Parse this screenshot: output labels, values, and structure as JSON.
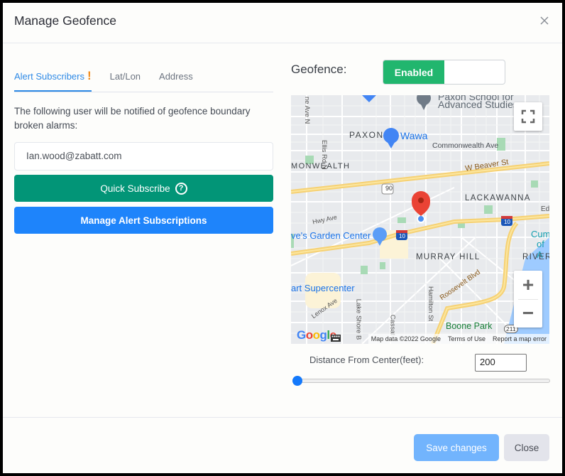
{
  "dialog": {
    "title": "Manage Geofence",
    "close_icon": "close-x-icon"
  },
  "tabs": [
    {
      "label": "Alert Subscribers",
      "active": true,
      "badge": "!"
    },
    {
      "label": "Lat/Lon",
      "active": false
    },
    {
      "label": "Address",
      "active": false
    }
  ],
  "subscribers": {
    "description": "The following user will be notified of geofence boundary broken alarms:",
    "email": "Ian.wood@zabatt.com",
    "quick_subscribe_label": "Quick Subscribe",
    "quick_subscribe_help": "?",
    "manage_label": "Manage Alert Subscriptions"
  },
  "geofence": {
    "label": "Geofence:",
    "toggle_state": "Enabled",
    "enabled": true
  },
  "map": {
    "labels": {
      "paxon_school": "Paxon School for",
      "advanced_studies": "Advanced Studies",
      "paxon": "PAXON",
      "wawa": "Wawa",
      "commonwealth_ave": "Commonwealth Ave",
      "commonwealth": "MONWEALTH",
      "beaver_st": "W Beaver St",
      "us90": "90",
      "lackawanna": "LACKAWANNA",
      "ed": "Ed",
      "hwy_ave": "Hwy Ave",
      "garden_center": "ve's Garden Center",
      "i10": "10",
      "cummer": "Cumm",
      "cummer2": "of A",
      "murray_hill": "MURRAY HILL",
      "river": "RIVER",
      "supercenter": "art Supercenter",
      "roosevelt": "Roosevelt Blvd",
      "lenox": "Lenox Ave",
      "lake_shore": "Lake Shore B",
      "cassat": "Cassat",
      "hamilton": "Hamilton St",
      "boone_park": "Boone Park",
      "sr211": "211",
      "ellis_rd": "Ellis Rd N",
      "lane_ave": "ne Ave N"
    },
    "google_logo": "Google",
    "map_data": "Map data ©2022 Google",
    "terms": "Terms of Use",
    "report": "Report a map error",
    "zoom_in": "+",
    "zoom_out": "−"
  },
  "distance": {
    "label": "Distance From Center(feet):",
    "value": "200",
    "slider_fraction": 0.0
  },
  "footer": {
    "save_label": "Save changes",
    "close_label": "Close"
  }
}
